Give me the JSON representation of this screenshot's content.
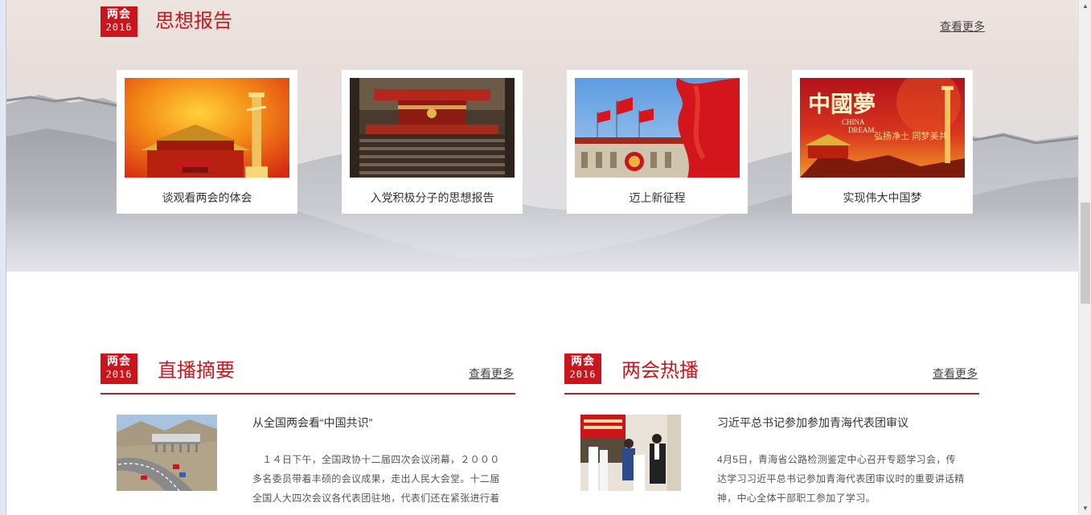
{
  "colors": {
    "accent": "#c9161d",
    "divider": "#a8242a"
  },
  "think_section": {
    "logo": {
      "line1": "两会",
      "line2": "2016"
    },
    "title": "思想报告",
    "more": "查看更多",
    "cards": [
      {
        "caption": "谈观看两会的体会"
      },
      {
        "caption": "入党积极分子的思想报告"
      },
      {
        "caption": "迈上新征程"
      },
      {
        "caption": "实现伟大中国梦"
      }
    ],
    "dream_overlay": {
      "chinese": "中國夢",
      "english1": "CHINA",
      "english2": "DREAM",
      "slogan": "弘扬净土 同梦美共"
    }
  },
  "live_section": {
    "logo": {
      "line1": "两会",
      "line2": "2016"
    },
    "title": "直播摘要",
    "more": "查看更多",
    "item": {
      "title": "从全国两会看“中国共识”",
      "body_lines": [
        "　１４日下午，全国政协十二届四次会议闭幕，２０００",
        "多名委员带着丰硕的会议成果，走出人民大会堂。十二届",
        "全国人大四次会议各代表团驻地，代表们还在紧张进行着"
      ]
    }
  },
  "hot_section": {
    "logo": {
      "line1": "两会",
      "line2": "2016"
    },
    "title": "两会热播",
    "more": "查看更多",
    "item": {
      "title": "习近平总书记参加参加青海代表团审议",
      "body_lines": [
        "4月5日，青海省公路检测鉴定中心召开专题学习会，传",
        "达学习习近平总书记参加青海代表团审议时的重要讲话精",
        "神，中心全体干部职工参加了学习。"
      ]
    }
  }
}
